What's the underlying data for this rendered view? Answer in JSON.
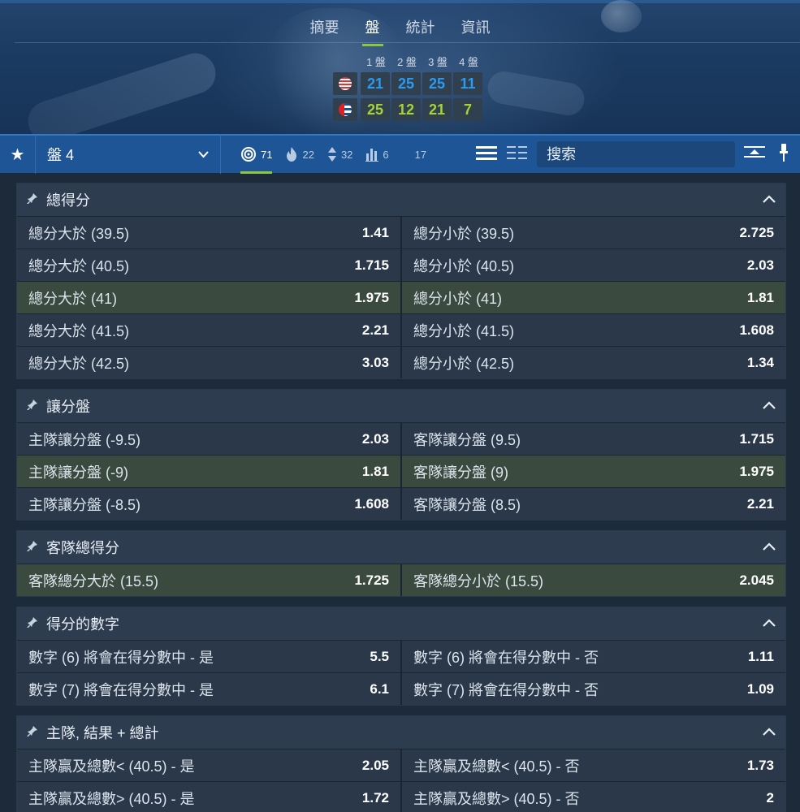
{
  "tabs": [
    "摘要",
    "盤",
    "統計",
    "資訊"
  ],
  "active_tab": 1,
  "scoreboard": {
    "set_labels": [
      "1 盤",
      "2 盤",
      "3 盤",
      "4 盤"
    ],
    "home": {
      "flag_icon": "usa-flag-icon",
      "scores": [
        "21",
        "25",
        "25",
        "11"
      ]
    },
    "away": {
      "flag_icon": "cuba-flag-icon",
      "scores": [
        "25",
        "12",
        "21",
        "7"
      ]
    }
  },
  "toolbar": {
    "selected_set": "盤 4",
    "counts": [
      {
        "icon": "target-icon",
        "value": "71",
        "active": true
      },
      {
        "icon": "fire-icon",
        "value": "22"
      },
      {
        "icon": "up-down-arrows-icon",
        "value": "32"
      },
      {
        "icon": "bar-chart-icon",
        "value": "6"
      },
      {
        "icon": "blank",
        "value": "17"
      }
    ],
    "search_placeholder": "搜索"
  },
  "markets": [
    {
      "title": "總得分",
      "rows": [
        {
          "a_label": "總分大於 (39.5)",
          "a_odds": "1.41",
          "b_label": "總分小於 (39.5)",
          "b_odds": "2.725"
        },
        {
          "a_label": "總分大於 (40.5)",
          "a_odds": "1.715",
          "b_label": "總分小於 (40.5)",
          "b_odds": "2.03"
        },
        {
          "a_label": "總分大於 (41)",
          "a_odds": "1.975",
          "b_label": "總分小於 (41)",
          "b_odds": "1.81",
          "highlight": true
        },
        {
          "a_label": "總分大於 (41.5)",
          "a_odds": "2.21",
          "b_label": "總分小於 (41.5)",
          "b_odds": "1.608"
        },
        {
          "a_label": "總分大於 (42.5)",
          "a_odds": "3.03",
          "b_label": "總分小於 (42.5)",
          "b_odds": "1.34"
        }
      ]
    },
    {
      "title": "讓分盤",
      "rows": [
        {
          "a_label": "主隊讓分盤 (-9.5)",
          "a_odds": "2.03",
          "b_label": "客隊讓分盤 (9.5)",
          "b_odds": "1.715"
        },
        {
          "a_label": "主隊讓分盤 (-9)",
          "a_odds": "1.81",
          "b_label": "客隊讓分盤 (9)",
          "b_odds": "1.975",
          "highlight": true
        },
        {
          "a_label": "主隊讓分盤 (-8.5)",
          "a_odds": "1.608",
          "b_label": "客隊讓分盤 (8.5)",
          "b_odds": "2.21"
        }
      ]
    },
    {
      "title": "客隊總得分",
      "rows": [
        {
          "a_label": "客隊總分大於 (15.5)",
          "a_odds": "1.725",
          "b_label": "客隊總分小於 (15.5)",
          "b_odds": "2.045",
          "highlight": true
        }
      ]
    },
    {
      "title": "得分的數字",
      "rows": [
        {
          "a_label": "數字 (6) 將會在得分數中 - 是",
          "a_odds": "5.5",
          "b_label": "數字 (6) 將會在得分數中 - 否",
          "b_odds": "1.11"
        },
        {
          "a_label": "數字 (7) 將會在得分數中 - 是",
          "a_odds": "6.1",
          "b_label": "數字 (7) 將會在得分數中 - 否",
          "b_odds": "1.09"
        }
      ]
    },
    {
      "title": "主隊, 結果 + 總計",
      "rows": [
        {
          "a_label": "主隊贏及總數< (40.5) - 是",
          "a_odds": "2.05",
          "b_label": "主隊贏及總數< (40.5) - 否",
          "b_odds": "1.73"
        },
        {
          "a_label": "主隊贏及總數> (40.5) - 是",
          "a_odds": "1.72",
          "b_label": "主隊贏及總數> (40.5) - 否",
          "b_odds": "2"
        }
      ]
    }
  ],
  "colors": {
    "accent_green": "#8dc63f",
    "home_score": "#2a9bf0",
    "away_score": "#a6d23a",
    "toolbar_blue": "#1d5597",
    "highlight_row": "#3b4a3e"
  }
}
